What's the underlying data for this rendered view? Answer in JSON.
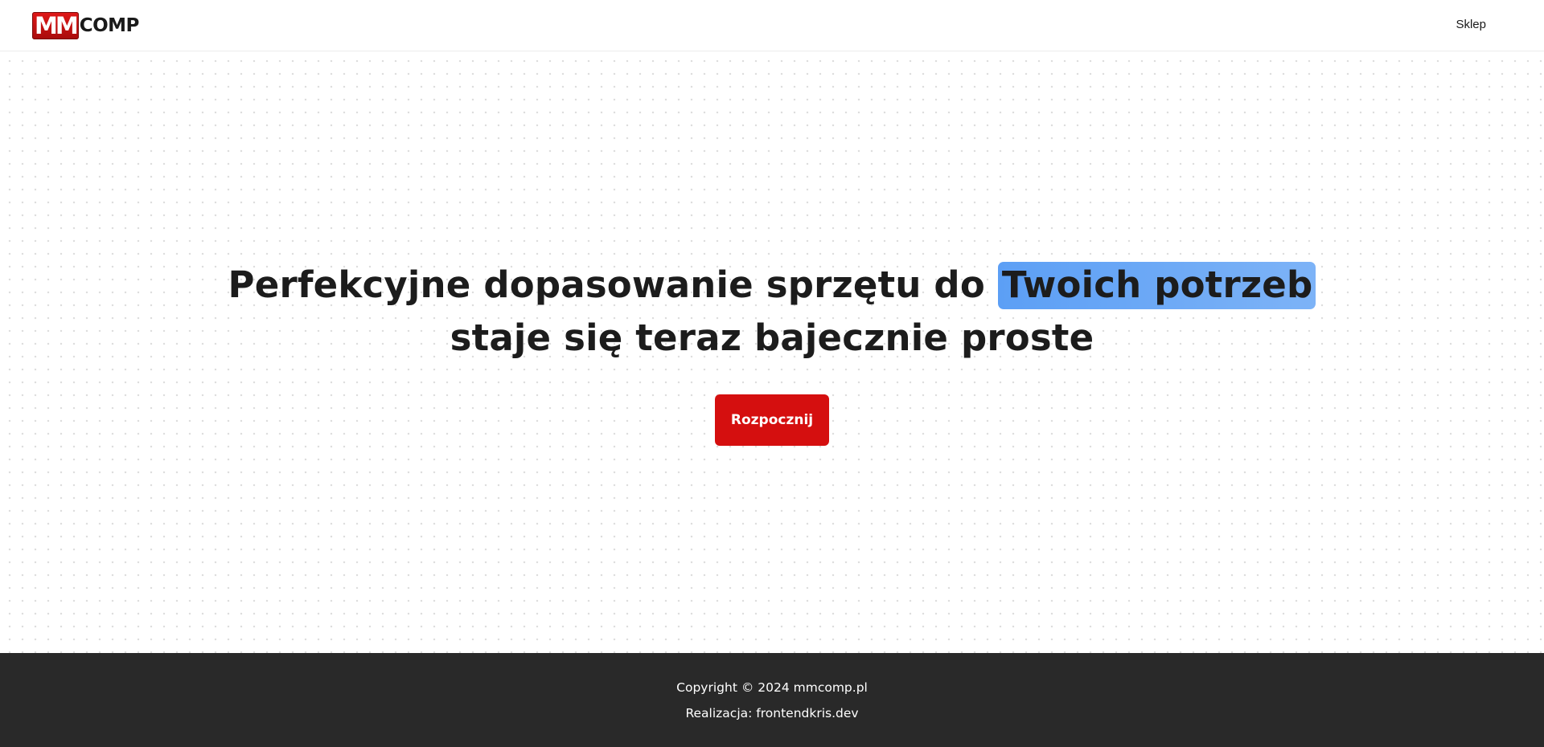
{
  "header": {
    "logo": {
      "mm_text": "MM",
      "comp_text": "COMP",
      "brand_red": "#d50f0f"
    },
    "nav": {
      "shop_label": "Sklep"
    }
  },
  "hero": {
    "headline_part1": "Perfekcyjne dopasowanie sprzętu do ",
    "headline_highlight": "Twoich potrzeb",
    "headline_part2": "staje się teraz bajecznie proste",
    "highlight_color": "#6aa8f6",
    "cta_label": "Rozpocznij",
    "cta_color": "#d50f0f"
  },
  "footer": {
    "copyright": "Copyright © 2024 mmcomp.pl",
    "credit_prefix": "Realizacja: ",
    "credit_link": "frontendkris.dev",
    "background_color": "#292929"
  }
}
